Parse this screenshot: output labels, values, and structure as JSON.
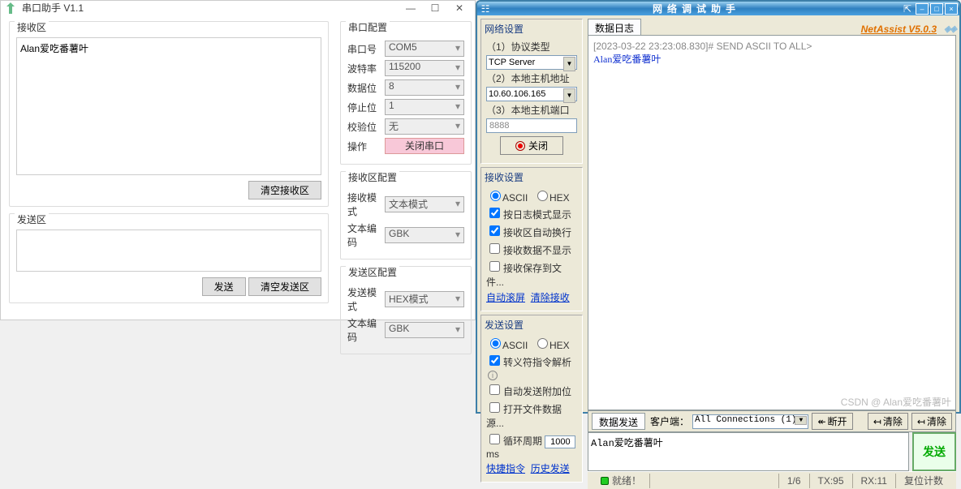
{
  "winA": {
    "title": "串口助手 V1.1",
    "rx": {
      "legend": "接收区",
      "content": "Alan爱吃番薯叶",
      "clear_btn": "清空接收区"
    },
    "tx": {
      "legend": "发送区",
      "content": "",
      "send_btn": "发送",
      "clear_btn": "清空发送区"
    },
    "cfg": {
      "legend": "串口配置",
      "port_l": "串口号",
      "port_v": "COM5",
      "baud_l": "波特率",
      "baud_v": "115200",
      "data_l": "数据位",
      "data_v": "8",
      "stop_l": "停止位",
      "stop_v": "1",
      "check_l": "校验位",
      "check_v": "无",
      "op_l": "操作",
      "op_btn": "关闭串口"
    },
    "rxcfg": {
      "legend": "接收区配置",
      "mode_l": "接收模式",
      "mode_v": "文本模式",
      "enc_l": "文本编码",
      "enc_v": "GBK"
    },
    "txcfg": {
      "legend": "发送区配置",
      "mode_l": "发送模式",
      "mode_v": "HEX模式",
      "enc_l": "文本编码",
      "enc_v": "GBK"
    }
  },
  "winB": {
    "title": "网络调试助手",
    "brand": "NetAssist V5.0.3",
    "net": {
      "legend": "网络设置",
      "proto_l": "（1）协议类型",
      "proto_v": "TCP Server",
      "host_l": "（2）本地主机地址",
      "host_v": "10.60.106.165",
      "port_l": "（3）本地主机端口",
      "port_v": "8888",
      "close_btn": "关闭"
    },
    "rxset": {
      "legend": "接收设置",
      "ascii": "ASCII",
      "hex": "HEX",
      "c1": "按日志模式显示",
      "c2": "接收区自动换行",
      "c3": "接收数据不显示",
      "c4": "接收保存到文件...",
      "link1": "自动滚屏",
      "link2": "清除接收"
    },
    "txset": {
      "legend": "发送设置",
      "ascii": "ASCII",
      "hex": "HEX",
      "c1": "转义符指令解析",
      "c2": "自动发送附加位",
      "c3": "打开文件数据源...",
      "cycle_l": "循环周期",
      "cycle_v": "1000",
      "cycle_u": "ms",
      "link1": "快捷指令",
      "link2": "历史发送"
    },
    "log": {
      "tab": "数据日志",
      "line1": "[2023-03-22 23:23:08.830]# SEND ASCII TO ALL>",
      "line2": "Alan爱吃番薯叶"
    },
    "sendbar": {
      "tab": "数据发送",
      "client_l": "客户端：",
      "client_v": "All Connections (1)",
      "disc": "断开",
      "clear_l": "清除",
      "clear_r": "清除"
    },
    "send": {
      "content": "Alan爱吃番薯叶",
      "btn": "发送"
    },
    "status": {
      "ready": "就绪！",
      "page": "1/6",
      "tx": "TX:95",
      "rx": "RX:11",
      "reset": "复位计数"
    },
    "watermark": "CSDN @ Alan爱吃番薯叶"
  }
}
